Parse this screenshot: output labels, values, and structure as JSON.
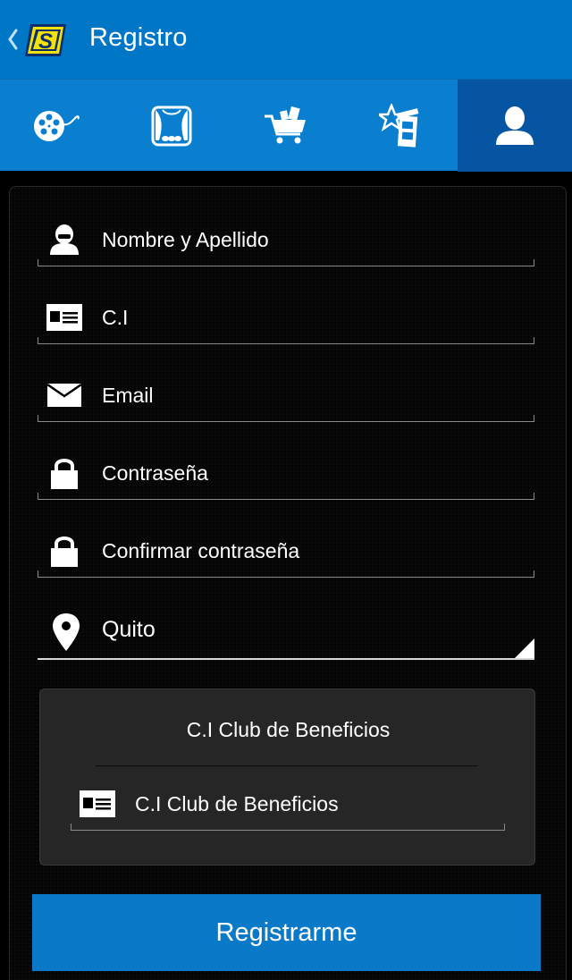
{
  "appbar": {
    "title": "Registro",
    "logo_text": "S",
    "back_icon": "chevron-left-icon"
  },
  "tabs": [
    {
      "icon": "film-reel-icon",
      "active": false
    },
    {
      "icon": "theater-stage-icon",
      "active": false
    },
    {
      "icon": "shopping-cart-icon",
      "active": false
    },
    {
      "icon": "star-film-icon",
      "active": false
    },
    {
      "icon": "user-icon",
      "active": true
    }
  ],
  "form": {
    "name_placeholder": "Nombre y Apellido",
    "ci_placeholder": "C.I",
    "email_placeholder": "Email",
    "password_placeholder": "Contraseña",
    "confirm_password_placeholder": "Confirmar contraseña",
    "city_value": "Quito"
  },
  "club": {
    "title": "C.I Club de Beneficios",
    "ci_placeholder": "C.I Club de Beneficios"
  },
  "register_label": "Registrarme",
  "colors": {
    "appbar": "#0077c6",
    "tabbar": "#0a7fd0",
    "tab_active": "#0555a2",
    "button": "#0a79c8",
    "logo_yellow": "#f5e10a"
  }
}
